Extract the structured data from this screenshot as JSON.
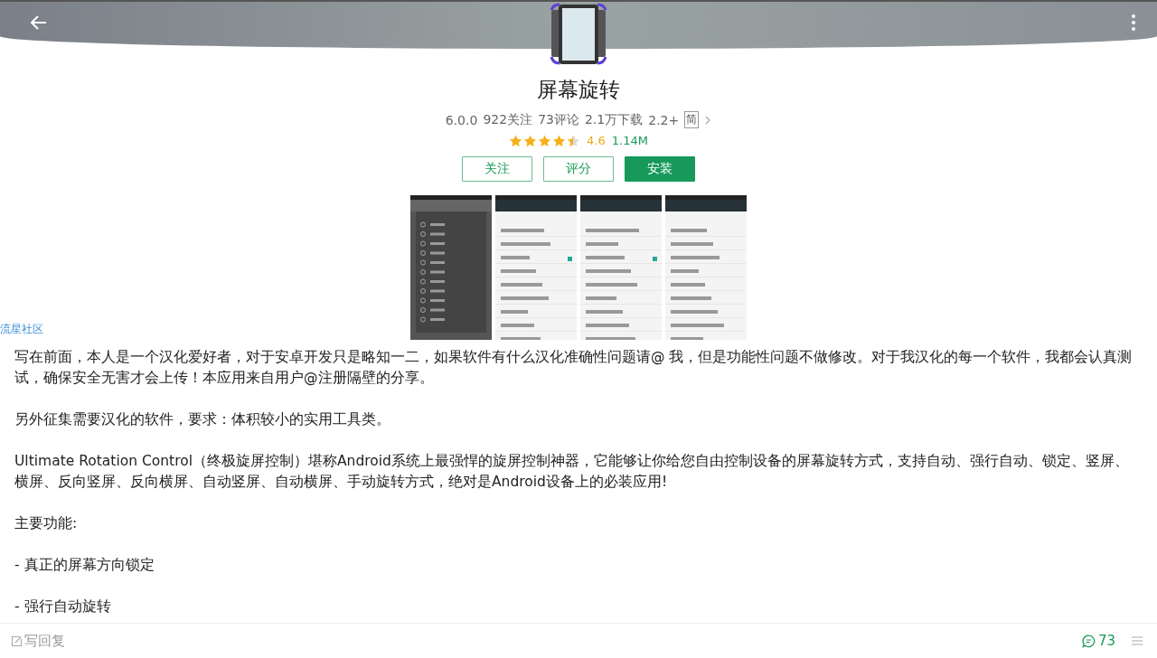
{
  "app": {
    "name": "屏幕旋转",
    "meta": [
      "6.0.0",
      "922关注",
      "73评论",
      "2.1万下载",
      "2.2+"
    ],
    "lang_badge": "简",
    "stars": 4.5,
    "rating": "4.6",
    "rating_count": "1.14M"
  },
  "buttons": [
    {
      "label": "关注",
      "kind": "outline"
    },
    {
      "label": "评分",
      "kind": "outline"
    },
    {
      "label": "安装",
      "kind": "primary"
    }
  ],
  "source": "流星社区",
  "paragraphs": [
    "写在前面，本人是一个汉化爱好者，对于安卓开发只是略知一二，如果软件有什么汉化准确性问题请@ 我，但是功能性问题不做修改。对于我汉化的每一个软件，我都会认真测试，确保安全无害才会上传！本应用来自用户@注册隔壁的分享。",
    "另外征集需要汉化的软件，要求：体积较小的实用工具类。",
    "Ultimate Rotation Control（终极旋屏控制）堪称Android系统上最强悍的旋屏控制神器，它能够让你给您自由控制设备的屏幕旋转方式，支持自动、强行自动、锁定、竖屏、横屏、反向竖屏、反向横屏、自动竖屏、自动横屏、手动旋转方式，绝对是Android设备上的必装应用!",
    "主要功能:",
    "- 真正的屏幕方向锁定",
    "- 强行自动旋转"
  ],
  "bottom_bar": {
    "reply": "写回复",
    "comment_count": "73"
  }
}
